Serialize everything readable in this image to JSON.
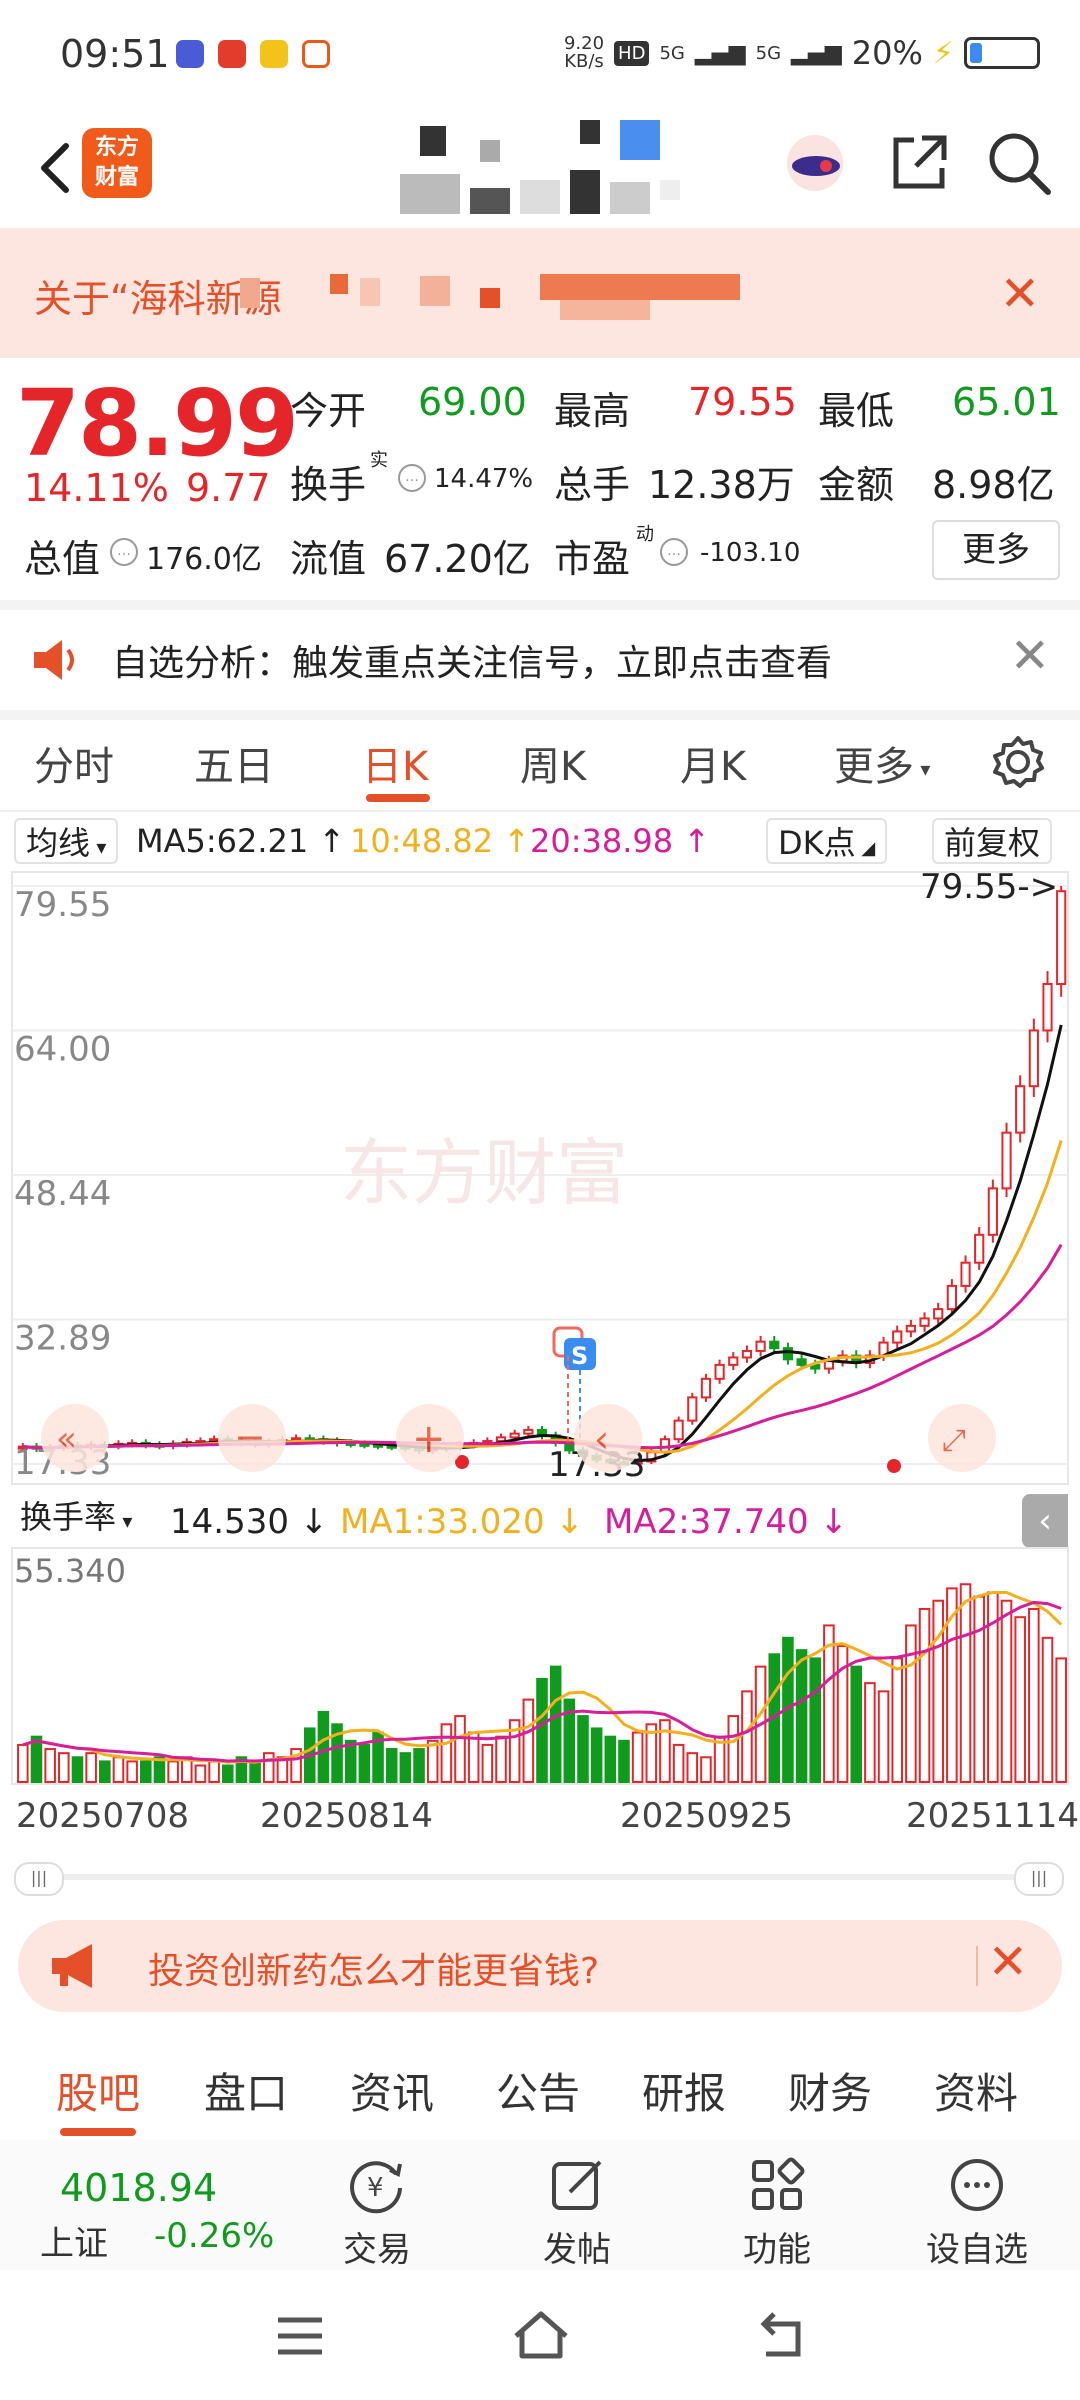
{
  "status_bar": {
    "time": "09:51",
    "network_speed_value": "9.20",
    "network_speed_unit": "KB/s",
    "hd": "HD",
    "sim1": "5G",
    "sim2": "5G",
    "battery": "20%"
  },
  "header": {
    "logo_text": "东方财富",
    "icons": [
      "back-arrow",
      "ad-badge",
      "share-icon",
      "search-icon"
    ]
  },
  "banner": {
    "text": "关于“海科新源",
    "close": "✕"
  },
  "quote": {
    "price": "78.99",
    "change_pct": "14.11%",
    "change_amt": "9.77",
    "open_label": "今开",
    "open_value": "69.00",
    "high_label": "最高",
    "high_value": "79.55",
    "low_label": "最低",
    "low_value": "65.01",
    "turnover_label": "换手",
    "turnover_sup": "实",
    "turnover_value": "14.47%",
    "volume_label": "总手",
    "volume_value": "12.38万",
    "amount_label": "金额",
    "amount_value": "8.98亿",
    "mktcap_label": "总值",
    "mktcap_value": "176.0亿",
    "float_label": "流值",
    "float_value": "67.20亿",
    "pe_label": "市盈",
    "pe_sup": "动",
    "pe_value": "-103.10",
    "more": "更多"
  },
  "notice": {
    "text": "自选分析：触发重点关注信号，立即点击查看",
    "close": "✕"
  },
  "kline_tabs": {
    "items": [
      "分时",
      "五日",
      "日K",
      "周K",
      "月K",
      "更多"
    ],
    "active": "日K"
  },
  "ma_bar": {
    "selector": "均线",
    "ma5": "MA5:62.21",
    "ma10": "10:48.82",
    "ma20": "20:38.98",
    "dk": "DK点",
    "adjust": "前复权"
  },
  "price_chart": {
    "axis_labels": [
      "79.55",
      "64.00",
      "48.44",
      "32.89",
      "17.33"
    ],
    "high_marker": "79.55->",
    "low_marker": "17.33",
    "watermark": "东方财富",
    "signal_s": "S"
  },
  "volume_bar": {
    "selector": "换手率",
    "value": "14.530",
    "ma1": "MA1:33.020",
    "ma2": "MA2:37.740",
    "axis_top": "55.340"
  },
  "dates": [
    "20250708",
    "20250814",
    "20250925",
    "20251114"
  ],
  "colors": {
    "up": "#e4262a",
    "down": "#109a1e",
    "accent": "#e4502a",
    "ma5": "#111111",
    "ma10": "#f2b01e",
    "ma20": "#d61e9a"
  },
  "ad": {
    "text": "投资创新药怎么才能更省钱?",
    "close": "✕"
  },
  "bottom_tabs": {
    "items": [
      "股吧",
      "盘口",
      "资讯",
      "公告",
      "研报",
      "财务",
      "资料"
    ],
    "active": "股吧"
  },
  "footer": {
    "index_value": "4018.94",
    "index_name": "上证",
    "index_change": "-0.26%",
    "trade": "交易",
    "post": "发帖",
    "functions": "功能",
    "watchlist": "设自选"
  },
  "chart_data": [
    {
      "type": "candlestick",
      "title": "",
      "ylim": [
        17.33,
        79.55
      ],
      "yticks": [
        79.55,
        64.0,
        48.44,
        32.89,
        17.33
      ],
      "series": [
        {
          "name": "MA5",
          "last": 62.21
        },
        {
          "name": "MA10",
          "last": 48.82
        },
        {
          "name": "MA20",
          "last": 38.98
        }
      ],
      "close_series": [
        19.2,
        19.0,
        19.1,
        19.3,
        19.2,
        19.4,
        19.3,
        19.5,
        19.6,
        19.4,
        19.3,
        19.5,
        19.7,
        19.8,
        20.0,
        19.8,
        19.6,
        19.5,
        19.7,
        19.9,
        20.1,
        20.0,
        19.8,
        19.6,
        19.5,
        19.4,
        19.3,
        19.2,
        19.0,
        18.8,
        19.0,
        19.2,
        19.4,
        19.6,
        19.8,
        20.2,
        20.6,
        21.0,
        20.4,
        19.6,
        18.8,
        18.2,
        17.8,
        17.5,
        17.4,
        17.6,
        18.6,
        20.0,
        22.0,
        24.5,
        26.5,
        28.0,
        28.8,
        29.5,
        30.5,
        29.8,
        28.6,
        28.0,
        27.6,
        28.4,
        29.0,
        28.2,
        29.0,
        30.4,
        31.6,
        32.2,
        33.0,
        34.0,
        36.5,
        39.0,
        42.0,
        47.0,
        53.0,
        58.0,
        64.0,
        69.0,
        78.99
      ]
    },
    {
      "type": "bar",
      "title": "换手率",
      "ylim": [
        0,
        55.34
      ],
      "series": [
        {
          "name": "MA1",
          "last": 33.02
        },
        {
          "name": "MA2",
          "last": 37.74
        }
      ],
      "values": [
        9,
        11,
        8,
        7,
        6,
        7,
        5,
        6,
        5,
        5,
        6,
        5,
        6,
        4,
        5,
        4,
        6,
        5,
        7,
        6,
        8,
        13,
        17,
        14,
        10,
        9,
        12,
        8,
        7,
        8,
        10,
        14,
        16,
        12,
        9,
        11,
        15,
        20,
        25,
        28,
        20,
        16,
        13,
        11,
        10,
        12,
        14,
        15,
        9,
        7,
        6,
        11,
        16,
        22,
        28,
        31,
        35,
        32,
        30,
        38,
        33,
        28,
        24,
        22,
        30,
        38,
        42,
        44,
        47,
        48,
        45,
        46,
        44,
        40,
        42,
        35,
        30
      ]
    }
  ]
}
